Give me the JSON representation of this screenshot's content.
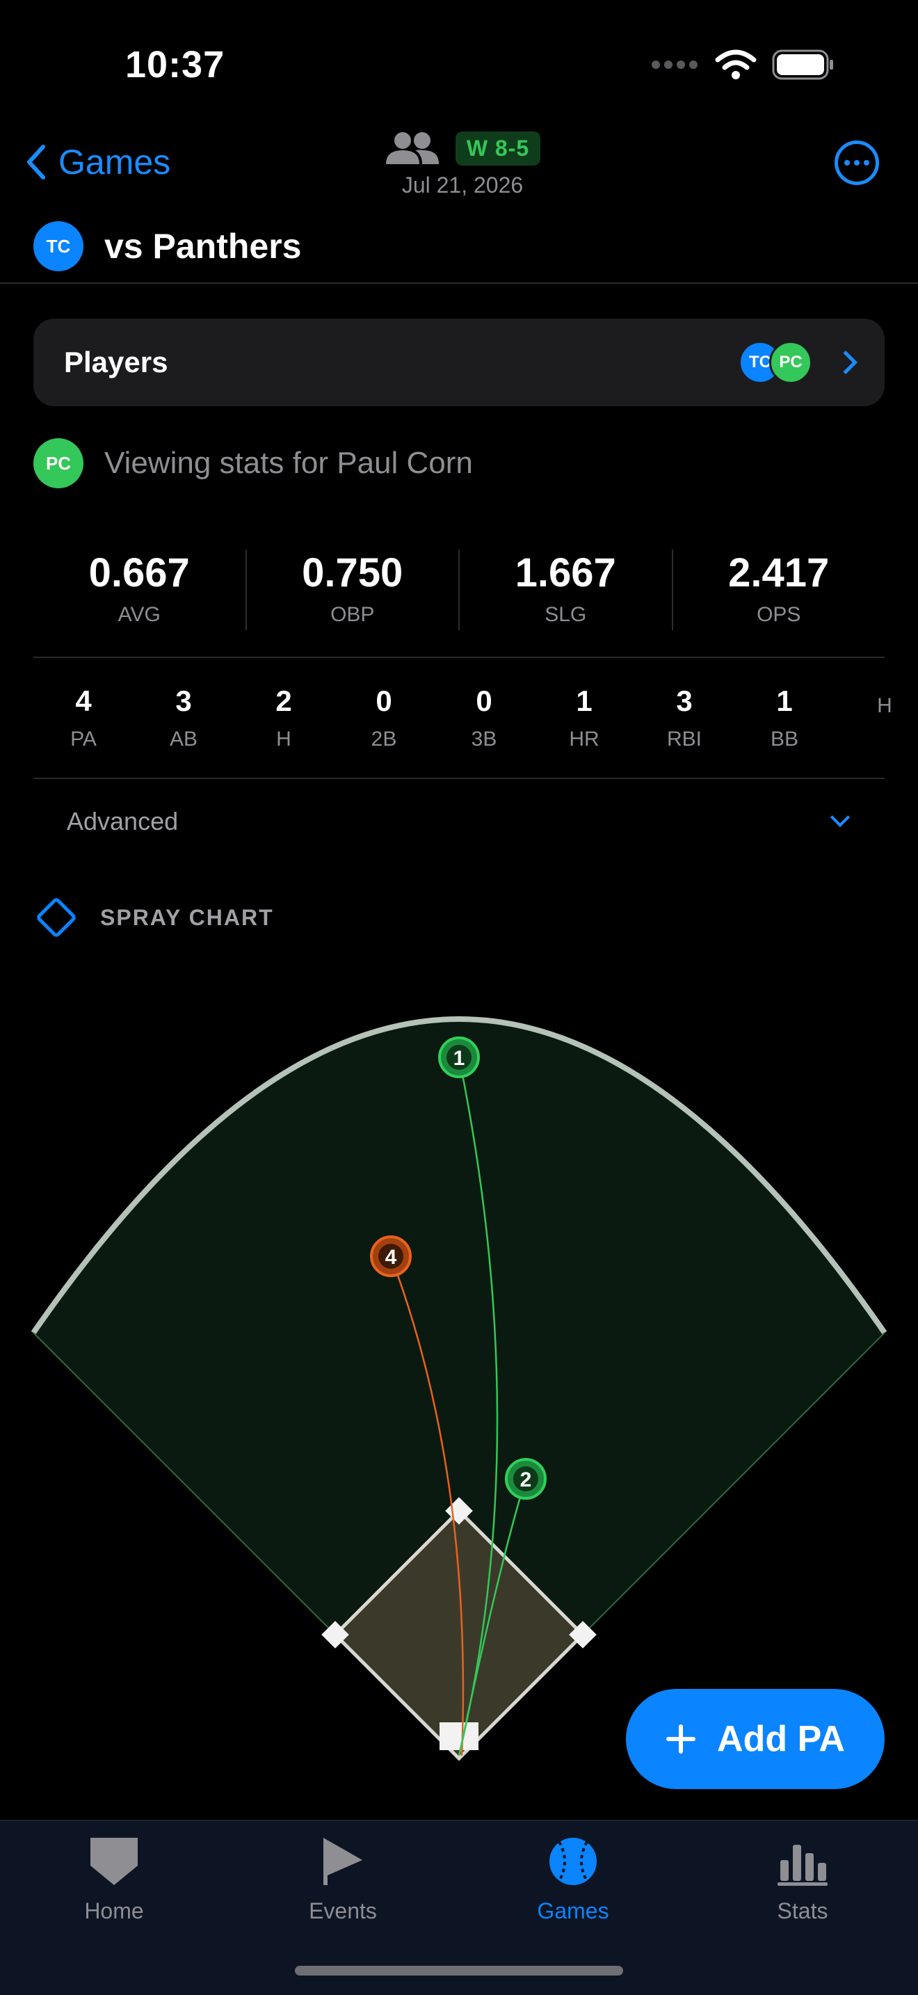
{
  "status_bar": {
    "time": "10:37"
  },
  "nav": {
    "back_label": "Games",
    "result_badge": "W 8-5",
    "date": "Jul 21, 2026",
    "team_avatar": "TC",
    "title": "vs Panthers"
  },
  "players_card": {
    "title": "Players",
    "avatars": [
      "TC",
      "PC"
    ]
  },
  "viewing": {
    "avatar": "PC",
    "text": "Viewing stats for Paul Corn"
  },
  "rate_stats": [
    {
      "value": "0.667",
      "label": "AVG"
    },
    {
      "value": "0.750",
      "label": "OBP"
    },
    {
      "value": "1.667",
      "label": "SLG"
    },
    {
      "value": "2.417",
      "label": "OPS"
    }
  ],
  "count_stats": [
    {
      "value": "4",
      "label": "PA"
    },
    {
      "value": "3",
      "label": "AB"
    },
    {
      "value": "2",
      "label": "H"
    },
    {
      "value": "0",
      "label": "2B"
    },
    {
      "value": "0",
      "label": "3B"
    },
    {
      "value": "1",
      "label": "HR"
    },
    {
      "value": "3",
      "label": "RBI"
    },
    {
      "value": "1",
      "label": "BB"
    },
    {
      "value": "",
      "label": "H"
    }
  ],
  "advanced": {
    "label": "Advanced"
  },
  "spray_chart": {
    "title": "SPRAY CHART",
    "hits": [
      {
        "label": "1",
        "color": "#34c759"
      },
      {
        "label": "4",
        "color": "#e8621f"
      },
      {
        "label": "2",
        "color": "#34c759"
      }
    ]
  },
  "add_pa": {
    "label": "Add PA"
  },
  "tab_bar": {
    "items": [
      {
        "label": "Home",
        "icon": "home-plate-icon",
        "active": false
      },
      {
        "label": "Events",
        "icon": "flag-icon",
        "active": false
      },
      {
        "label": "Games",
        "icon": "baseball-icon",
        "active": true
      },
      {
        "label": "Stats",
        "icon": "bar-chart-icon",
        "active": false
      }
    ]
  },
  "colors": {
    "accent": "#0a84ff",
    "win": "#34c759",
    "hit_orange": "#e8621f",
    "infield": "#3b3a2a",
    "outfield": "#0b1a10"
  }
}
